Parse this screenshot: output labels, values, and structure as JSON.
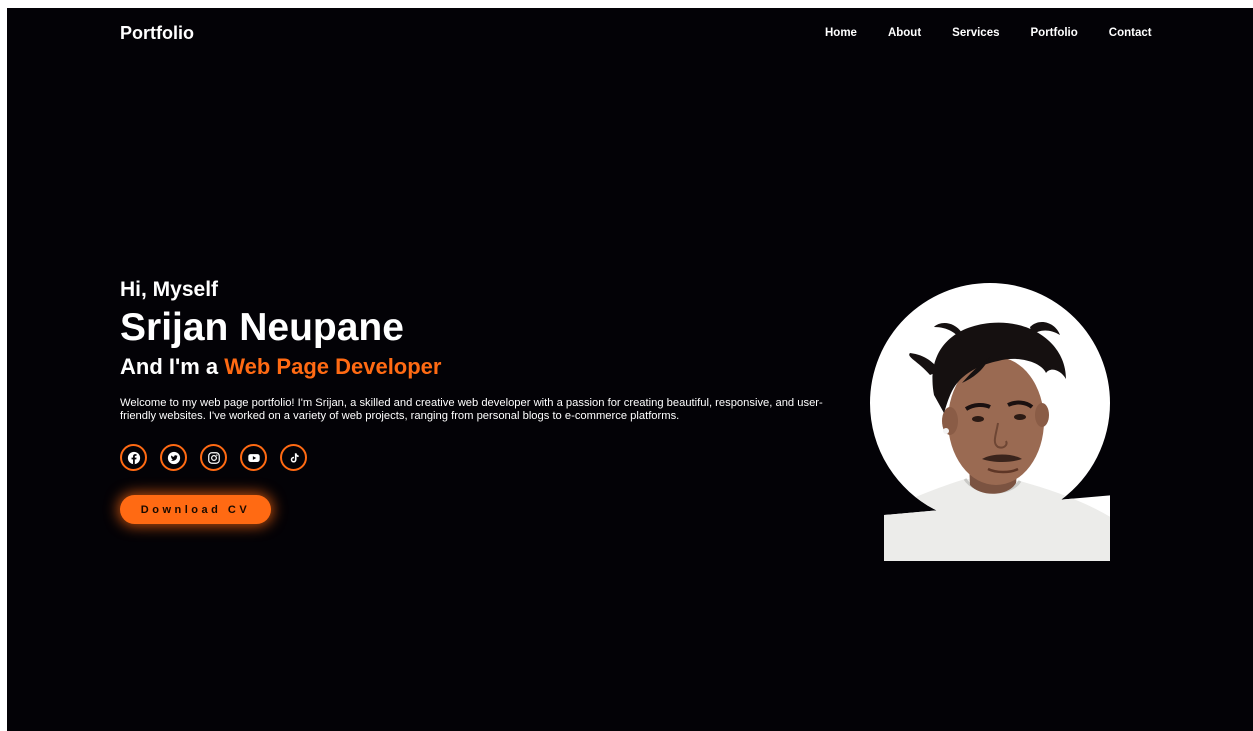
{
  "header": {
    "logo": "Portfolio",
    "nav": [
      "Home",
      "About",
      "Services",
      "Portfolio",
      "Contact"
    ]
  },
  "hero": {
    "greeting": "Hi, Myself",
    "name": "Srijan Neupane",
    "role_prefix": "And I'm a ",
    "role": "Web Page Developer",
    "bio": "Welcome to my web page portfolio! I'm Srijan, a skilled and creative web developer with a passion for creating beautiful, responsive, and user-friendly websites. I've worked on a variety of web projects, ranging from personal blogs to e-commerce platforms.",
    "socials": [
      "facebook-icon",
      "twitter-icon",
      "instagram-icon",
      "youtube-icon",
      "tiktok-icon"
    ],
    "cv_button": "Download CV"
  },
  "colors": {
    "accent": "#ff6a13",
    "background": "#030206",
    "text": "#ffffff"
  }
}
